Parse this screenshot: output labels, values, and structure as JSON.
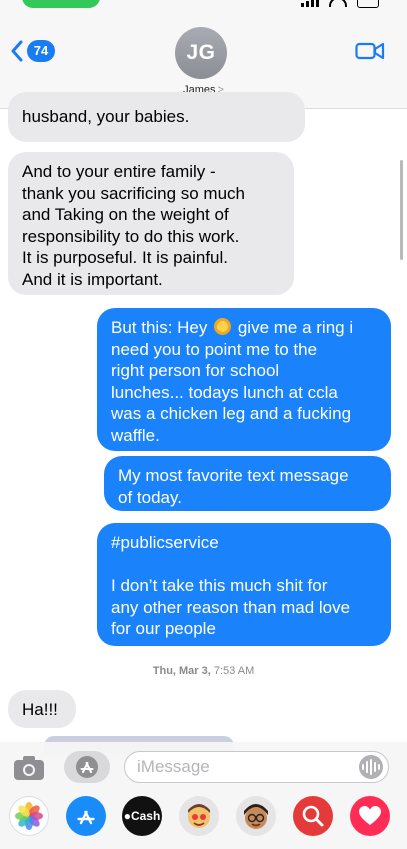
{
  "header": {
    "back_count": "74",
    "avatar_initials": "JG",
    "contact_name": "James",
    "contact_chevron": ">"
  },
  "messages": [
    {
      "direction": "incoming",
      "text": "husband, your babies."
    },
    {
      "direction": "incoming",
      "text": "And to your entire family -\nthank you sacrificing so much\nand Taking on the weight of\nresponsibility to do this work.\nIt is purposeful.  It is painful.\nAnd it is important."
    },
    {
      "direction": "outgoing",
      "text_before_emoji": "But this: Hey",
      "emoji": "sun-face-emoji",
      "text_after_emoji": "give me a ring i\nneed you to point me to the\nright person for school\nlunches...    todays lunch at ccla\nwas a chicken leg and a fucking\nwaffle."
    },
    {
      "direction": "outgoing",
      "text": "My most favorite text message\nof today."
    },
    {
      "direction": "outgoing",
      "text": "#publicservice\n\nI don’t take this much shit for\nany other reason than mad love\nfor our people"
    },
    {
      "direction": "incoming",
      "text": "Ha!!!"
    }
  ],
  "timestamp": {
    "day": "Thu, Mar 3,",
    "time": "7:53 AM"
  },
  "compose": {
    "placeholder": "iMessage"
  },
  "app_strip": {
    "cash_label": "Cash",
    "apps": [
      "photos-icon",
      "app-store-icon",
      "apple-cash-icon",
      "memoji-stickers-icon",
      "memoji-icon",
      "search-images-icon",
      "digital-touch-icon"
    ]
  },
  "colors": {
    "accent": "#1a7cf5",
    "outgoing_bubble": "#1a83fb",
    "incoming_bubble": "#e9e9eb",
    "status_pill": "#34c759"
  }
}
